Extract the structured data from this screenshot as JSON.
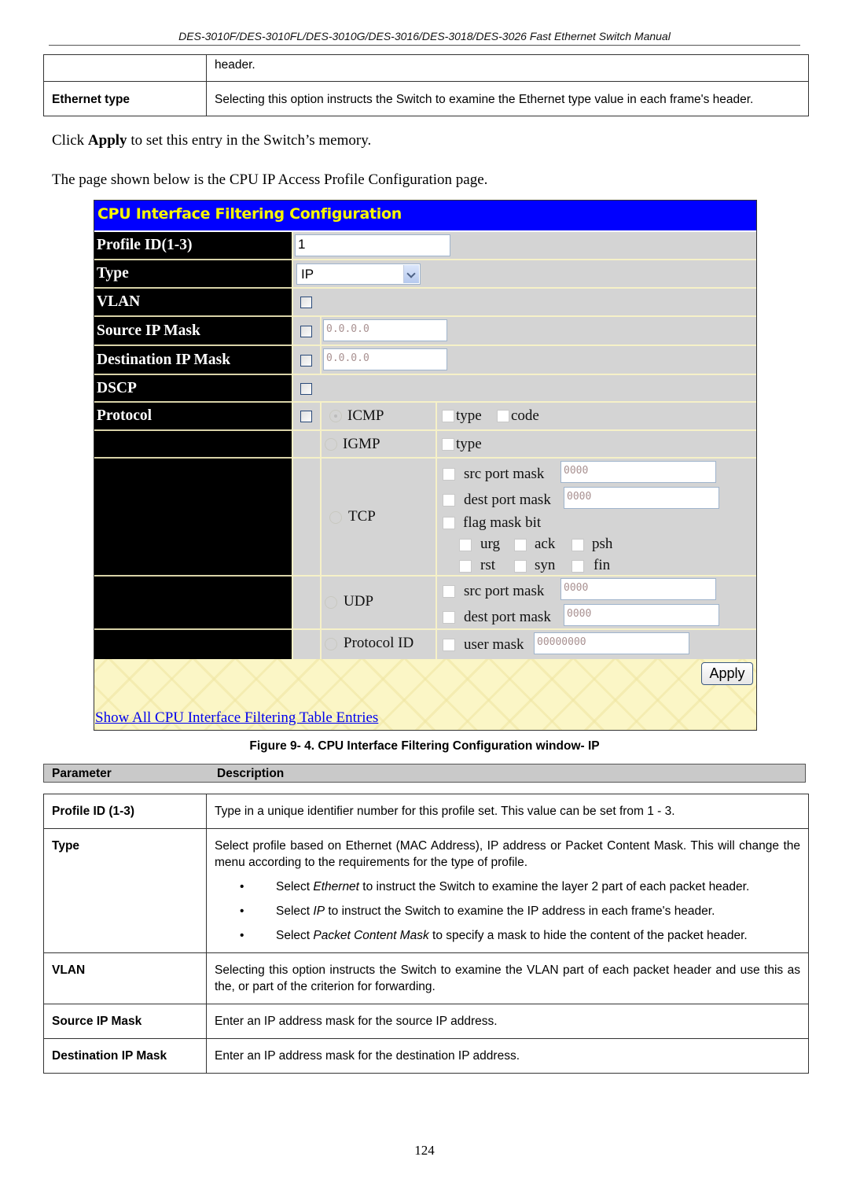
{
  "page_header": "DES-3010F/DES-3010FL/DES-3010G/DES-3016/DES-3018/DES-3026 Fast Ethernet Switch Manual",
  "top_table": {
    "rows": [
      {
        "param": "",
        "desc": "header."
      },
      {
        "param": "Ethernet type",
        "desc": "Selecting this option instructs the Switch to examine the Ethernet type value in each frame's header."
      }
    ]
  },
  "apply_sentence": {
    "pre": "Click ",
    "bold": "Apply",
    "post": " to set this entry in the Switch’s memory."
  },
  "intro_sentence": "The page shown below is the CPU IP Access Profile Configuration page.",
  "panel": {
    "title": "CPU Interface Filtering Configuration",
    "labels": {
      "profile_id": "Profile ID(1-3)",
      "type": "Type",
      "vlan": "VLAN",
      "source_ip_mask": "Source IP Mask",
      "destination_ip_mask": "Destination IP Mask",
      "dscp": "DSCP",
      "protocol": "Protocol"
    },
    "profile_id_value": "1",
    "type_selected": "IP",
    "source_ip_mask_value": "0.0.0.0",
    "destination_ip_mask_value": "0.0.0.0",
    "protocols": {
      "icmp": {
        "label": "ICMP",
        "selected": true,
        "options": [
          "type",
          "code"
        ]
      },
      "igmp": {
        "label": "IGMP",
        "selected": false,
        "options": [
          "type"
        ]
      },
      "tcp": {
        "label": "TCP",
        "selected": false,
        "src_port_mask_label": "src port mask",
        "src_port_mask_value": "0000",
        "dest_port_mask_label": "dest port mask",
        "dest_port_mask_value": "0000",
        "flag_mask_label": "flag mask bit",
        "flags": [
          "urg",
          "ack",
          "psh",
          "rst",
          "syn",
          "fin"
        ]
      },
      "udp": {
        "label": "UDP",
        "selected": false,
        "src_port_mask_label": "src port mask",
        "src_port_mask_value": "0000",
        "dest_port_mask_label": "dest port mask",
        "dest_port_mask_value": "0000"
      },
      "protocol_id": {
        "label": "Protocol ID",
        "selected": false,
        "user_mask_label": "user mask",
        "user_mask_value": "00000000"
      }
    },
    "apply_label": "Apply",
    "show_all_link": "Show All CPU Interface Filtering Table Entries",
    "colors": {
      "title_bg": "#0000ff",
      "title_text": "#f7f700",
      "label_bg": "#000000",
      "cell_bg": "#d4d4d4",
      "footer_bg": "#fbf6c6",
      "link": "#0000ee"
    }
  },
  "figure_caption": "Figure 9- 4. CPU Interface Filtering Configuration window- IP",
  "param_table": {
    "headers": [
      "Parameter",
      "Description"
    ],
    "rows": [
      {
        "param": "Profile ID (1-3)",
        "desc": "Type in a unique identifier number for this profile set. This value can be set from 1 - 3."
      },
      {
        "param": "Type",
        "desc": "Select profile based on Ethernet (MAC Address), IP address or Packet Content Mask. This will change the menu according to the requirements for the type of profile.",
        "bullets": [
          {
            "pre": "Select ",
            "em": "Ethernet",
            "post": " to instruct the Switch to examine the layer 2 part of each packet header."
          },
          {
            "pre": "Select ",
            "em": "IP",
            "post": " to instruct the Switch to examine the IP address in each frame's header."
          },
          {
            "pre": "Select ",
            "em": "Packet Content Mask",
            "post": " to specify a mask to hide the content of the packet header."
          }
        ]
      },
      {
        "param": "VLAN",
        "desc": "Selecting this option instructs the Switch to examine the VLAN part of each packet header and use this as the, or part of the criterion for forwarding."
      },
      {
        "param": "Source IP Mask",
        "desc": "Enter an IP address mask for the source IP address."
      },
      {
        "param": "Destination IP Mask",
        "desc": "Enter an IP address mask for the destination IP address."
      }
    ]
  },
  "page_number": "124"
}
